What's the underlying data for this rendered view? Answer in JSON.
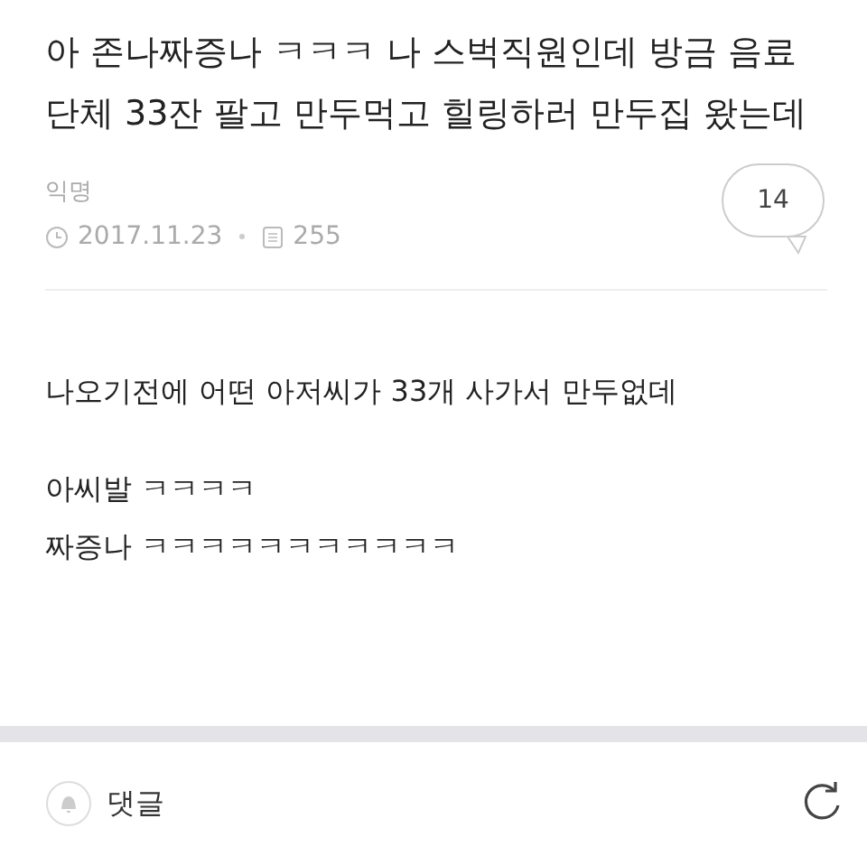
{
  "post": {
    "title": "아 존나짜증나 ㅋㅋㅋ 나 스벅직원인데 방금 음료 단체 33잔 팔고 만두먹고 힐링하러 만두집 왔는데",
    "author": "익명",
    "date": "2017.11.23",
    "views": "255",
    "comment_count": "14"
  },
  "body": [
    [
      "나오기전에 어떤 아저씨가 33개 사가서 만두없데"
    ],
    [
      "아씨발 ㅋㅋㅋㅋ",
      "짜증나 ㅋㅋㅋㅋㅋㅋㅋㅋㅋㅋㅋ"
    ]
  ],
  "footer": {
    "label": "댓글"
  }
}
